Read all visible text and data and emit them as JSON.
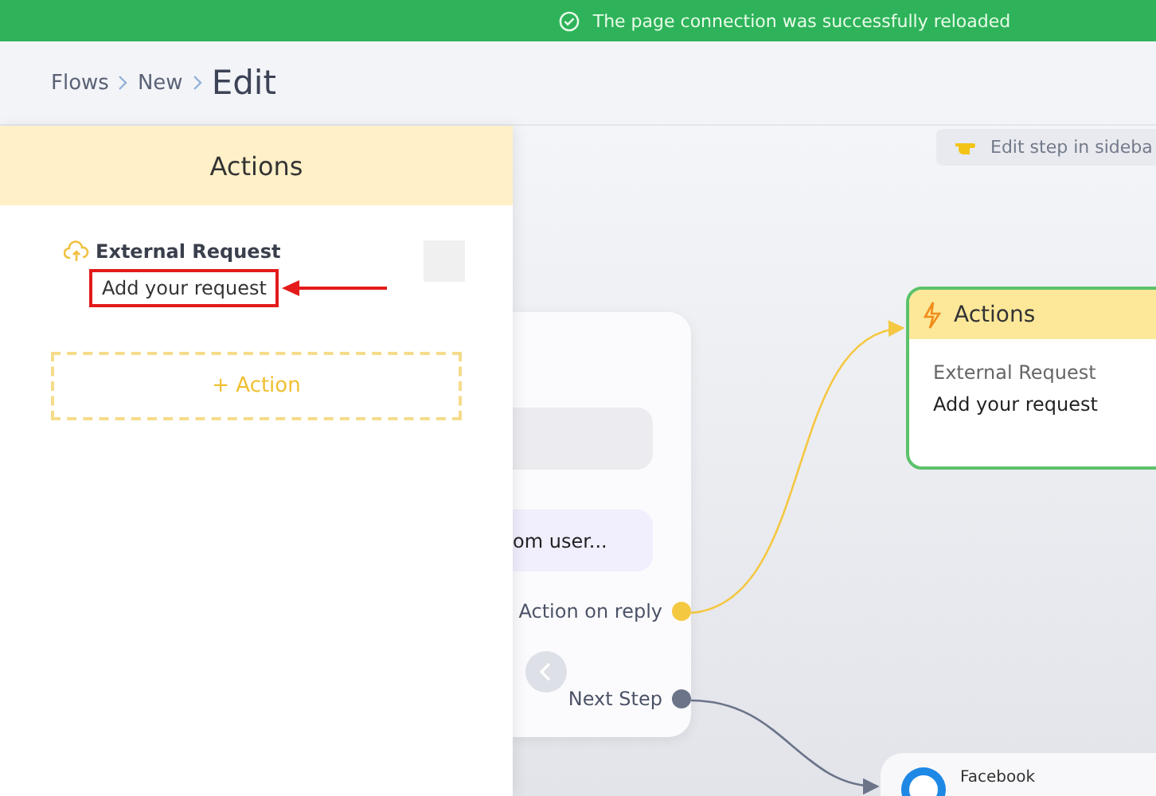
{
  "banner": {
    "message": "The page connection was successfully reloaded"
  },
  "breadcrumbs": [
    {
      "label": "Flows",
      "current": false
    },
    {
      "label": "New",
      "current": false
    },
    {
      "label": "Edit",
      "current": true
    }
  ],
  "sidebar": {
    "title": "Actions",
    "items": [
      {
        "title": "External Request",
        "subtitle": "Add your request",
        "highlighted": true
      }
    ],
    "add_button": "+ Action"
  },
  "canvas": {
    "hint": "Edit step in sideba",
    "step_node": {
      "message": "om user...",
      "outputs": [
        {
          "label": "Action on reply",
          "color": "#f5c842"
        },
        {
          "label": "Next Step",
          "color": "#6b7489"
        }
      ]
    },
    "actions_node": {
      "title": "Actions",
      "selected": true,
      "item_title": "External Request",
      "item_subtitle": "Add your request"
    },
    "facebook_node": {
      "title": "Facebook"
    }
  }
}
